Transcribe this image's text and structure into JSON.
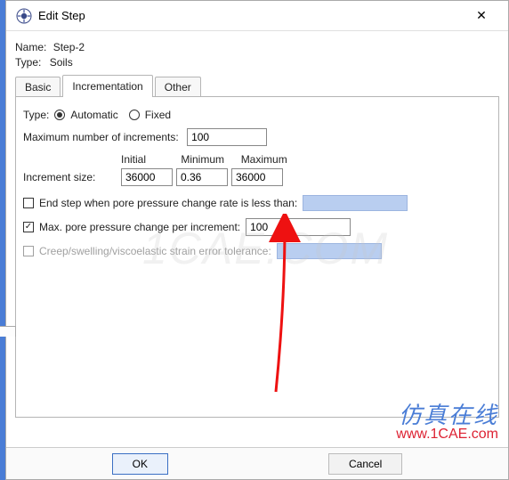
{
  "window": {
    "title": "Edit Step",
    "close": "✕"
  },
  "header": {
    "name_label": "Name:",
    "name_value": "Step-2",
    "type_label": "Type:",
    "type_value": "Soils"
  },
  "tabs": {
    "basic": "Basic",
    "incr": "Incrementation",
    "other": "Other"
  },
  "form": {
    "type_label": "Type:",
    "auto": "Automatic",
    "fixed": "Fixed",
    "max_incr_label": "Maximum number of increments:",
    "max_incr_value": "100",
    "col_initial": "Initial",
    "col_min": "Minimum",
    "col_max": "Maximum",
    "inc_size_label": "Increment size:",
    "inc_initial": "36000",
    "inc_min": "0.36",
    "inc_max": "36000",
    "endstep_label": "End step when pore pressure change rate is less than:",
    "maxpore_label": "Max. pore pressure change per increment:",
    "maxpore_value": "100",
    "creep_label": "Creep/swelling/viscoelastic strain error tolerance:"
  },
  "buttons": {
    "ok": "OK",
    "cancel": "Cancel"
  },
  "watermark": {
    "big": "1CAE.COM",
    "cn": "仿真在线",
    "url": "www.1CAE.com"
  }
}
